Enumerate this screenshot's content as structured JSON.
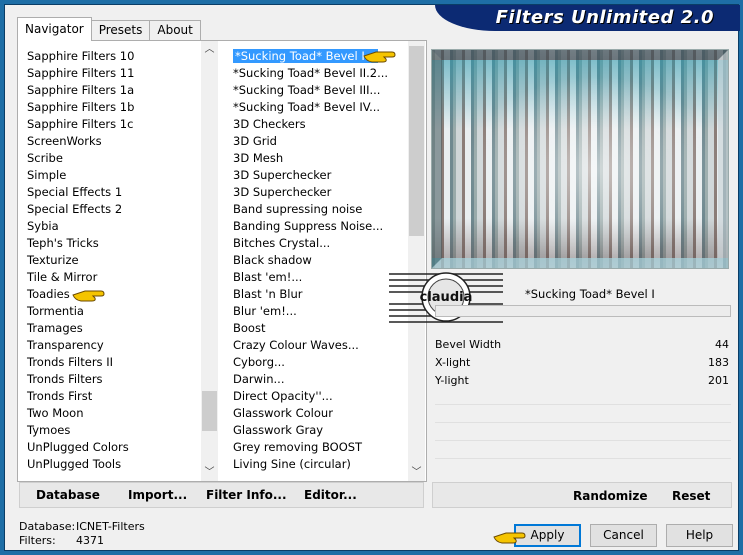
{
  "title": "Filters Unlimited 2.0",
  "tabs": [
    "Navigator",
    "Presets",
    "About"
  ],
  "categories": [
    "Sapphire Filters 10",
    "Sapphire Filters 11",
    "Sapphire Filters 1a",
    "Sapphire Filters 1b",
    "Sapphire Filters 1c",
    "ScreenWorks",
    "Scribe",
    "Simple",
    "Special Effects 1",
    "Special Effects 2",
    "Sybia",
    "Teph's Tricks",
    "Texturize",
    "Tile & Mirror",
    "Toadies",
    "Tormentia",
    "Tramages",
    "Transparency",
    "Tronds Filters II",
    "Tronds Filters",
    "Tronds First",
    "Two Moon",
    "Tymoes",
    "UnPlugged Colors",
    "UnPlugged Tools"
  ],
  "filters": [
    "*Sucking Toad*  Bevel I...",
    "*Sucking Toad*  Bevel II.2...",
    "*Sucking Toad*  Bevel III...",
    "*Sucking Toad*  Bevel IV...",
    "3D Checkers",
    "3D Grid",
    "3D Mesh",
    "3D Superchecker",
    "3D Superchecker",
    "Band supressing noise",
    "Banding Suppress Noise...",
    "Bitches Crystal...",
    "Black shadow",
    "Blast 'em!...",
    "Blast 'n Blur",
    "Blur 'em!...",
    "Boost",
    "Crazy Colour Waves...",
    "Cyborg...",
    "Darwin...",
    "Direct Opacity''...",
    "Glasswork Colour",
    "Glasswork Gray",
    "Grey removing BOOST",
    "Living Sine (circular)"
  ],
  "left_buttons": {
    "database": "Database",
    "import": "Import...",
    "filter_info": "Filter Info...",
    "editor": "Editor..."
  },
  "right_buttons": {
    "randomize": "Randomize",
    "reset": "Reset"
  },
  "selected_filter_name": "*Sucking Toad*  Bevel I",
  "params": [
    {
      "name": "Bevel Width",
      "value": "44"
    },
    {
      "name": "X-light",
      "value": "183"
    },
    {
      "name": "Y-light",
      "value": "201"
    }
  ],
  "status": {
    "database_label": "Database:",
    "database_value": "ICNET-Filters",
    "filters_label": "Filters:",
    "filters_value": "4371"
  },
  "dialog_buttons": {
    "apply": "Apply",
    "cancel": "Cancel",
    "help": "Help"
  },
  "watermark": "claudia",
  "colors": {
    "selection": "#3399ff",
    "banner": "#0c2a73",
    "frame": "#1e6ea6"
  }
}
